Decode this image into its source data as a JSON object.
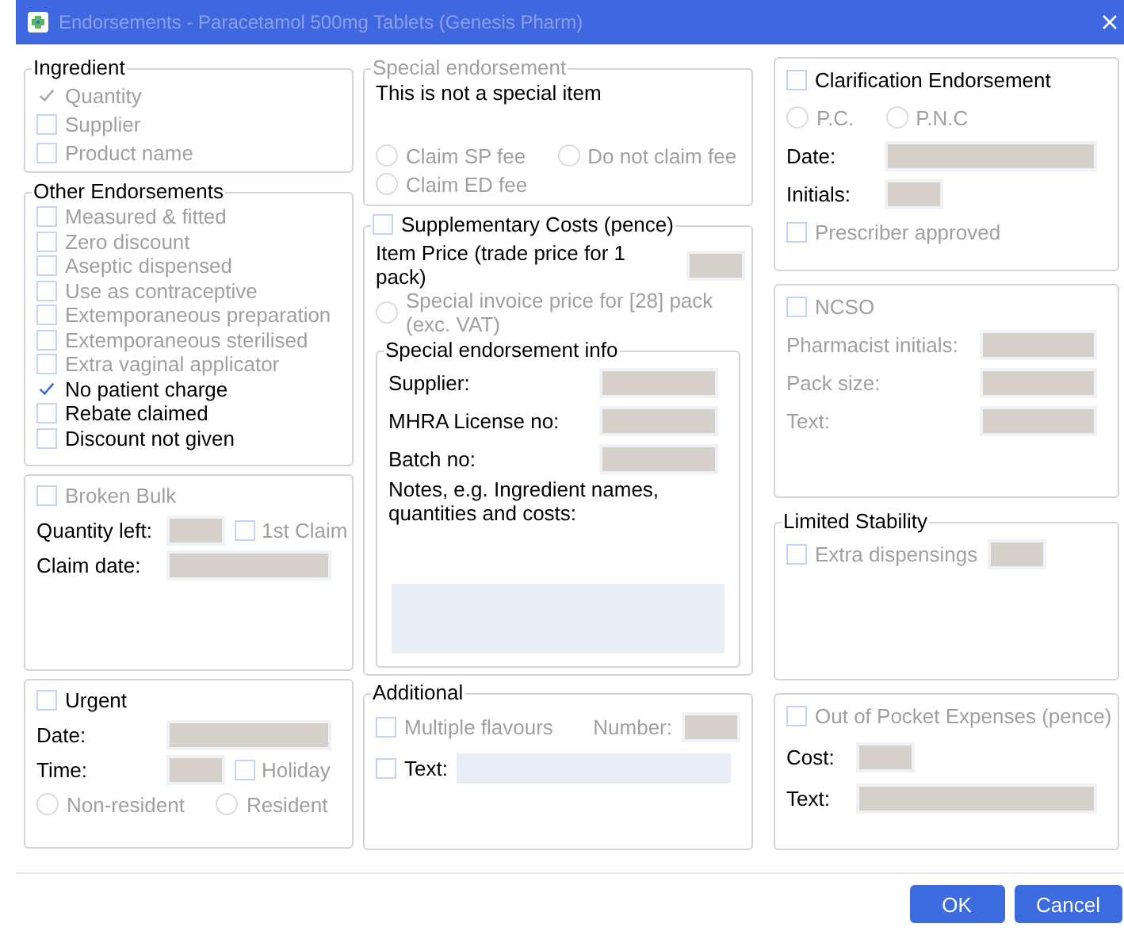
{
  "window": {
    "title": "Endorsements - Paracetamol 500mg Tablets (Genesis Pharm)"
  },
  "columns": [
    [
      {
        "title": "Ingredient",
        "title_disabled": false,
        "rows": [
          [
            {
              "kind": "check",
              "label": "Quantity",
              "checked": true,
              "disabled": true
            }
          ],
          [
            {
              "kind": "check",
              "label": "Supplier",
              "checked": false,
              "disabled": true
            }
          ],
          [
            {
              "kind": "check",
              "label": "Product name",
              "checked": false,
              "disabled": true
            }
          ]
        ]
      },
      {
        "title": "Other Endorsements",
        "title_disabled": false,
        "rows": [
          [
            {
              "kind": "check",
              "label": "Measured & fitted",
              "checked": false,
              "disabled": true
            }
          ],
          [
            {
              "kind": "check",
              "label": "Zero discount",
              "checked": false,
              "disabled": true
            }
          ],
          [
            {
              "kind": "check",
              "label": "Aseptic dispensed",
              "checked": false,
              "disabled": true
            }
          ],
          [
            {
              "kind": "check",
              "label": "Use as contraceptive",
              "checked": false,
              "disabled": true
            }
          ],
          [
            {
              "kind": "check",
              "label": "Extemporaneous preparation",
              "checked": false,
              "disabled": true
            }
          ],
          [
            {
              "kind": "check",
              "label": "Extemporaneous sterilised",
              "checked": false,
              "disabled": true
            }
          ],
          [
            {
              "kind": "check",
              "label": "Extra vaginal applicator",
              "checked": false,
              "disabled": true
            }
          ],
          [
            {
              "kind": "check",
              "label": "No patient charge",
              "checked": true,
              "disabled": false
            }
          ],
          [
            {
              "kind": "check",
              "label": "Rebate claimed",
              "checked": false,
              "disabled": false
            }
          ],
          [
            {
              "kind": "check",
              "label": "Discount not given",
              "checked": false,
              "disabled": false
            }
          ]
        ]
      },
      {
        "rows": [
          [
            {
              "kind": "check",
              "label": "Broken Bulk",
              "checked": false,
              "disabled": true
            }
          ],
          [
            {
              "kind": "label",
              "text": "Quantity left:",
              "disabled": false
            },
            {
              "kind": "small-field",
              "disabled": true
            },
            {
              "kind": "check",
              "label": "1st Claim",
              "checked": false,
              "disabled": true
            }
          ],
          [
            {
              "kind": "label",
              "text": "Claim date:",
              "disabled": false
            },
            {
              "kind": "field",
              "disabled": true
            }
          ]
        ]
      },
      {
        "rows": [
          [
            {
              "kind": "check",
              "label": "Urgent",
              "checked": false,
              "disabled": false
            }
          ],
          [
            {
              "kind": "label",
              "text": "Date:",
              "disabled": false
            },
            {
              "kind": "field",
              "disabled": true
            }
          ],
          [
            {
              "kind": "label",
              "text": "Time:",
              "disabled": false
            },
            {
              "kind": "small-field",
              "disabled": true
            },
            {
              "kind": "check",
              "label": "Holiday",
              "checked": false,
              "disabled": true
            }
          ],
          [
            {
              "kind": "radio",
              "label": "Non-resident",
              "selected": false,
              "disabled": true
            },
            {
              "kind": "radio",
              "label": "Resident",
              "selected": false,
              "disabled": true
            }
          ]
        ]
      }
    ],
    [
      {
        "title": "Special endorsement",
        "title_disabled": true,
        "rows": [
          [
            {
              "kind": "text",
              "text": "This is not a special item"
            }
          ],
          [
            {
              "kind": "radio",
              "label": "Claim SP fee",
              "selected": false,
              "disabled": true
            },
            {
              "kind": "radio",
              "label": "Do not claim fee",
              "selected": false,
              "disabled": true
            }
          ],
          [
            {
              "kind": "radio",
              "label": "Claim ED fee",
              "selected": false,
              "disabled": true
            }
          ]
        ]
      },
      {
        "header": {
          "kind": "check",
          "label": "Supplementary Costs (pence)",
          "checked": false,
          "disabled": false
        },
        "rows": [
          [
            {
              "kind": "label",
              "text": "Item Price (trade price for 1 pack)",
              "disabled": false
            },
            {
              "kind": "small-field",
              "disabled": true
            }
          ],
          [
            {
              "kind": "radio",
              "label": "Special invoice price for [28] pack (exc. VAT)",
              "selected": false,
              "disabled": true
            }
          ],
          [
            {
              "kind": "group",
              "title": "Special endorsement info",
              "title_disabled": false,
              "rows": [
                [
                  {
                    "kind": "label",
                    "text": "Supplier:",
                    "disabled": false
                  },
                  {
                    "kind": "field",
                    "disabled": true
                  }
                ],
                [
                  {
                    "kind": "label",
                    "text": "MHRA License no:",
                    "disabled": false
                  },
                  {
                    "kind": "field",
                    "disabled": true
                  }
                ],
                [
                  {
                    "kind": "label",
                    "text": "Batch no:",
                    "disabled": false
                  },
                  {
                    "kind": "field",
                    "disabled": true
                  }
                ],
                [
                  {
                    "kind": "text",
                    "text": "Notes, e.g. Ingredient names, quantities and costs:"
                  }
                ],
                [
                  {
                    "kind": "notes",
                    "disabled": false
                  }
                ]
              ]
            }
          ]
        ]
      },
      {
        "title": "Additional",
        "title_disabled": false,
        "rows": [
          [
            {
              "kind": "check",
              "label": "Multiple flavours",
              "checked": false,
              "disabled": true
            },
            {
              "kind": "label",
              "text": "Number:",
              "disabled": true
            },
            {
              "kind": "small-field",
              "disabled": true
            }
          ],
          [
            {
              "kind": "check",
              "label": "Text:",
              "checked": false,
              "disabled": false
            },
            {
              "kind": "field",
              "disabled": false
            }
          ]
        ]
      }
    ],
    [
      {
        "rows": [
          [
            {
              "kind": "check",
              "label": "Clarification Endorsement",
              "checked": false,
              "disabled": false
            }
          ],
          [
            {
              "kind": "radio",
              "label": "P.C.",
              "selected": false,
              "disabled": true
            },
            {
              "kind": "radio",
              "label": "P.N.C",
              "selected": false,
              "disabled": true
            }
          ],
          [
            {
              "kind": "label",
              "text": "Date:",
              "disabled": false
            },
            {
              "kind": "field",
              "disabled": true
            }
          ],
          [
            {
              "kind": "label",
              "text": "Initials:",
              "disabled": false
            },
            {
              "kind": "small-field",
              "disabled": true
            }
          ],
          [
            {
              "kind": "check",
              "label": "Prescriber approved",
              "checked": false,
              "disabled": true
            }
          ]
        ]
      },
      {
        "rows": [
          [
            {
              "kind": "check",
              "label": "NCSO",
              "checked": false,
              "disabled": true
            }
          ],
          [
            {
              "kind": "label",
              "text": "Pharmacist initials:",
              "disabled": true
            },
            {
              "kind": "field",
              "disabled": true
            }
          ],
          [
            {
              "kind": "label",
              "text": "Pack size:",
              "disabled": true
            },
            {
              "kind": "field",
              "disabled": true
            }
          ],
          [
            {
              "kind": "label",
              "text": "Text:",
              "disabled": true
            },
            {
              "kind": "field",
              "disabled": true
            }
          ]
        ]
      },
      {
        "title": "Limited Stability",
        "title_disabled": false,
        "rows": [
          [
            {
              "kind": "check",
              "label": "Extra dispensings",
              "checked": false,
              "disabled": true
            },
            {
              "kind": "small-field",
              "disabled": true
            }
          ]
        ]
      },
      {
        "rows": [
          [
            {
              "kind": "check",
              "label": "Out of Pocket Expenses (pence)",
              "checked": false,
              "disabled": true
            }
          ],
          [
            {
              "kind": "label",
              "text": "Cost:",
              "disabled": false
            },
            {
              "kind": "small-field",
              "disabled": true
            }
          ],
          [
            {
              "kind": "label",
              "text": "Text:",
              "disabled": false
            },
            {
              "kind": "field",
              "disabled": true
            }
          ]
        ]
      }
    ]
  ],
  "buttons": [
    {
      "label": "OK"
    },
    {
      "label": "Cancel"
    }
  ]
}
